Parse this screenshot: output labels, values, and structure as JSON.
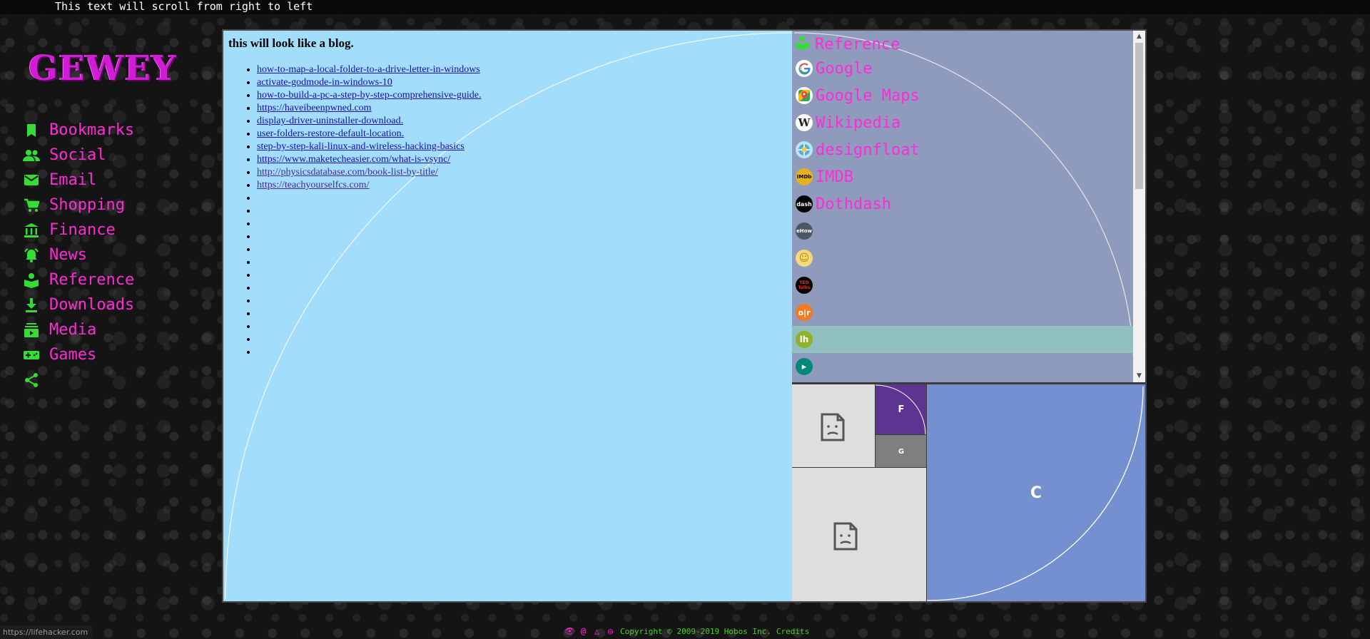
{
  "marquee": {
    "text": "This text will scroll from right to left"
  },
  "logo": {
    "text": "GEWEY"
  },
  "nav": {
    "items": [
      {
        "label": "Bookmarks",
        "icon": "bookmark-icon"
      },
      {
        "label": "Social",
        "icon": "people-icon"
      },
      {
        "label": "Email",
        "icon": "envelope-icon"
      },
      {
        "label": "Shopping",
        "icon": "cart-icon"
      },
      {
        "label": "Finance",
        "icon": "bank-icon"
      },
      {
        "label": "News",
        "icon": "alarm-icon"
      },
      {
        "label": "Reference",
        "icon": "book-icon"
      },
      {
        "label": "Downloads",
        "icon": "download-icon"
      },
      {
        "label": "Media",
        "icon": "media-icon"
      },
      {
        "label": "Games",
        "icon": "gamepad-icon"
      },
      {
        "label": "",
        "icon": "share-icon"
      }
    ],
    "icon_color": "#33dd33",
    "label_color": "#ff2bd6"
  },
  "blog": {
    "heading": "this will look like a blog.",
    "links": [
      "how-to-map-a-local-folder-to-a-drive-letter-in-windows",
      "activate-godmode-in-windows-10",
      "how-to-build-a-pc-a-step-by-step-comprehensive-guide.",
      "https://haveibeenpwned.com",
      "display-driver-uninstaller-download.",
      "user-folders-restore-default-location.",
      "step-by-step-kali-linux-and-wireless-hacking-basics",
      "https://www.maketecheasier.com/what-is-vsync/",
      "http://physicsdatabase.com/book-list-by-title/",
      "https://teachyourselfcs.com/"
    ],
    "empty_bullets": 13,
    "background": "#a2ddfb"
  },
  "reference": {
    "title": "Reference",
    "items": [
      {
        "label": "Google",
        "icon": "google-icon"
      },
      {
        "label": "Google Maps",
        "icon": "google-maps-icon"
      },
      {
        "label": "Wikipedia",
        "icon": "wikipedia-icon"
      },
      {
        "label": "designfloat",
        "icon": "designfloat-icon"
      },
      {
        "label": "IMDB",
        "icon": "imdb-icon"
      },
      {
        "label": "Dothdash",
        "icon": "dotdash-icon"
      },
      {
        "label": "",
        "icon": "ehow-icon"
      },
      {
        "label": "",
        "icon": "smiley-icon"
      },
      {
        "label": "",
        "icon": "ted-talks-icon"
      },
      {
        "label": "",
        "icon": "or-icon"
      },
      {
        "label": "",
        "icon": "lifehacker-icon",
        "highlighted": true
      },
      {
        "label": "",
        "icon": "bing-icon"
      }
    ],
    "background": "#8f9bbd"
  },
  "tiles": {
    "f": "F",
    "g": "G",
    "c": "C"
  },
  "status_bar": {
    "url": "https://lifehacker.com"
  },
  "footer": {
    "icons": [
      "👁",
      "@",
      "△",
      "◎"
    ],
    "copyright": "Copyright © 2009-2019 Hobos Inc.",
    "credits": "Credits"
  }
}
